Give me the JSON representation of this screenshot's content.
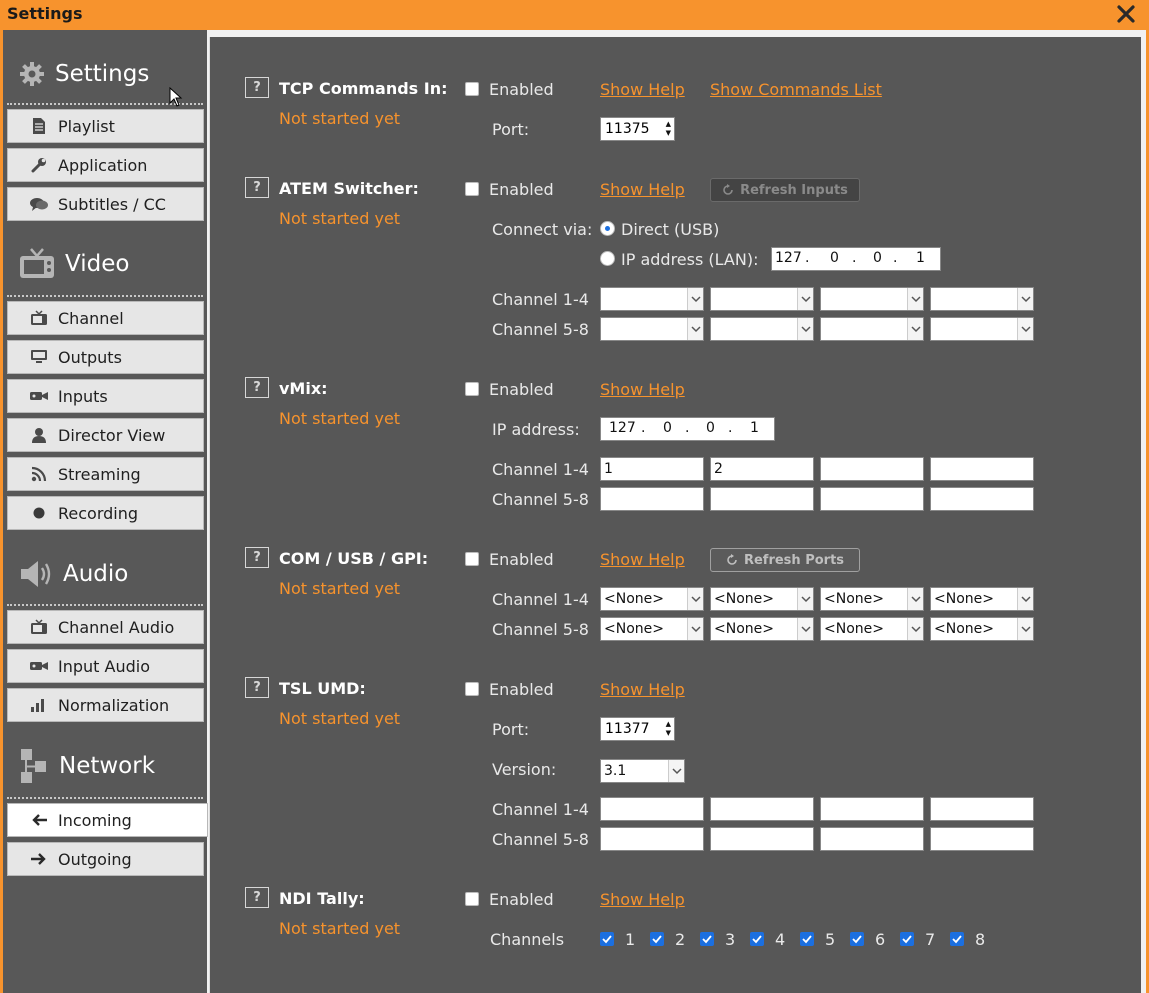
{
  "window": {
    "title": "Settings"
  },
  "sidebar": {
    "sections": [
      {
        "title": "Settings",
        "icon": "gear-icon"
      },
      {
        "title": "Video",
        "icon": "tv-icon"
      },
      {
        "title": "Audio",
        "icon": "speaker-icon"
      },
      {
        "title": "Network",
        "icon": "network-icon"
      }
    ],
    "items": [
      {
        "label": "Playlist",
        "icon": "document-icon"
      },
      {
        "label": "Application",
        "icon": "wrench-icon"
      },
      {
        "label": "Subtitles / CC",
        "icon": "chat-icon"
      },
      {
        "label": "Channel",
        "icon": "tv-small-icon"
      },
      {
        "label": "Outputs",
        "icon": "monitor-icon"
      },
      {
        "label": "Inputs",
        "icon": "camera-icon"
      },
      {
        "label": "Director View",
        "icon": "person-icon"
      },
      {
        "label": "Streaming",
        "icon": "rss-icon"
      },
      {
        "label": "Recording",
        "icon": "record-dot-icon"
      },
      {
        "label": "Channel Audio",
        "icon": "tv-small-icon"
      },
      {
        "label": "Input Audio",
        "icon": "camera-icon"
      },
      {
        "label": "Normalization",
        "icon": "bars-icon"
      },
      {
        "label": "Incoming",
        "icon": "arrow-left-icon",
        "active": true
      },
      {
        "label": "Outgoing",
        "icon": "arrow-right-icon"
      }
    ]
  },
  "common": {
    "enabled": "Enabled",
    "show_help": "Show Help",
    "not_started": "Not started yet",
    "q": "?",
    "port": "Port:",
    "ch14": "Channel 1-4",
    "ch58": "Channel 5-8"
  },
  "tcp": {
    "title": "TCP Commands In:",
    "commands_link": "Show Commands List",
    "port_value": "11375"
  },
  "atem": {
    "title": "ATEM Switcher:",
    "refresh": "Refresh Inputs",
    "connect_via": "Connect via:",
    "direct": "Direct (USB)",
    "ip_lan": "IP address (LAN):",
    "ip": [
      "127",
      "0",
      "0",
      "1"
    ]
  },
  "vmix": {
    "title": "vMix:",
    "ip_label": "IP address:",
    "ip": [
      "127",
      "0",
      "0",
      "1"
    ],
    "ch14": [
      "1",
      "2",
      "",
      ""
    ],
    "ch58": [
      "",
      "",
      "",
      ""
    ]
  },
  "com": {
    "title": "COM / USB / GPI:",
    "refresh": "Refresh Ports",
    "none": "<None>"
  },
  "tsl": {
    "title": "TSL UMD:",
    "port_value": "11377",
    "version_label": "Version:",
    "version_value": "3.1"
  },
  "ndi": {
    "title": "NDI Tally:",
    "channels_label": "Channels",
    "channels": [
      "1",
      "2",
      "3",
      "4",
      "5",
      "6",
      "7",
      "8"
    ]
  },
  "colors": {
    "accent": "#f7932d",
    "panel": "#575757",
    "sidebar": "#585858",
    "check": "#1b6fe0"
  }
}
